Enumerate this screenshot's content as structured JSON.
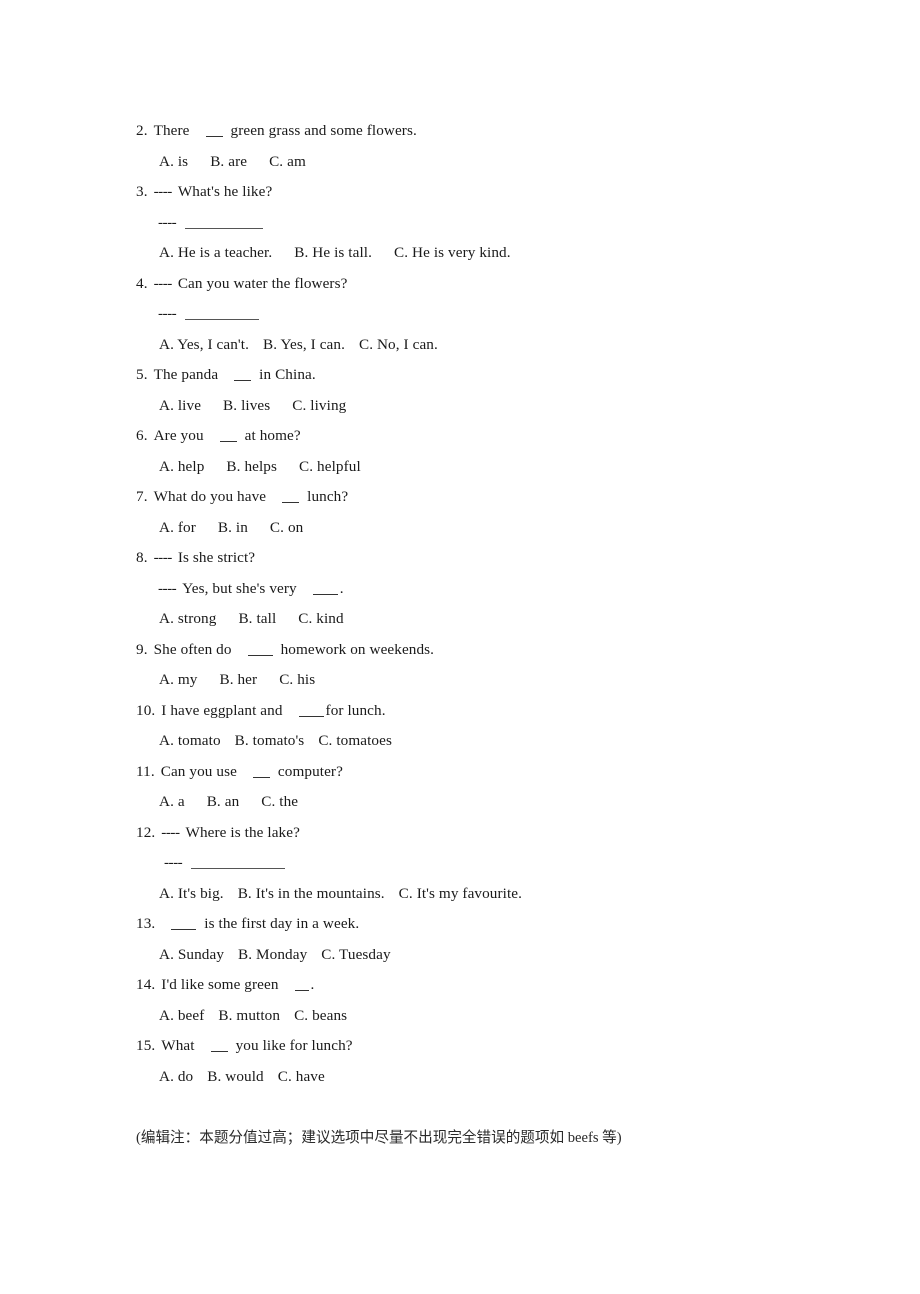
{
  "document": {
    "type": "english-multiple-choice-worksheet",
    "background_color": "#ffffff",
    "text_color": "#1a1a1a"
  },
  "questions": [
    {
      "number": "2.",
      "stem_before": "There",
      "stem_after": "green grass and some flowers.",
      "blank": "__",
      "options": [
        "A. is",
        "B. are",
        "C. am"
      ]
    },
    {
      "number": "3.",
      "prompt_dash": "----",
      "prompt": "What's he like?",
      "reply_dash": "----",
      "options": [
        "A. He is a teacher.",
        "B. He is tall.",
        "C. He is very kind."
      ]
    },
    {
      "number": "4.",
      "prompt_dash": "----",
      "prompt": "Can you water the flowers?",
      "reply_dash": "----",
      "options": [
        "A. Yes, I can't.",
        "B. Yes, I can.",
        "C. No, I can."
      ]
    },
    {
      "number": "5.",
      "stem_before": "The panda",
      "stem_after": "in China.",
      "blank": "__",
      "options": [
        "A. live",
        "B. lives",
        "C. living"
      ]
    },
    {
      "number": "6.",
      "stem_before": "Are you",
      "stem_after": "at home?",
      "blank": "__",
      "options": [
        "A. help",
        "B. helps",
        "C. helpful"
      ]
    },
    {
      "number": "7.",
      "stem_before": "What do you have",
      "stem_after": "lunch?",
      "blank": "__",
      "options": [
        "A. for",
        "B. in",
        "C. on"
      ]
    },
    {
      "number": "8.",
      "prompt_dash": "----",
      "prompt": "Is she strict?",
      "reply_dash": "----",
      "reply_before": "Yes, but she's very",
      "reply_after": ".",
      "reply_blank": "___",
      "options": [
        "A. strong",
        "B. tall",
        "C. kind"
      ]
    },
    {
      "number": "9.",
      "stem_before": "She often do",
      "stem_after": "homework on weekends.",
      "blank": "___",
      "options": [
        "A. my",
        "B. her",
        "C. his"
      ]
    },
    {
      "number": "10.",
      "stem_before": "I have eggplant and",
      "stem_after": "for lunch.",
      "blank": "___",
      "options": [
        "A. tomato",
        "B. tomato's",
        "C. tomatoes"
      ]
    },
    {
      "number": "11.",
      "stem_before": "Can you use",
      "stem_after": "computer?",
      "blank": "__",
      "options": [
        "A. a",
        "B. an",
        "C. the"
      ]
    },
    {
      "number": "12.",
      "prompt_dash": "----",
      "prompt": "Where is the lake?",
      "reply_dash": "----",
      "options": [
        "A. It's big.",
        "B. It's in the mountains.",
        "C. It's my favourite."
      ]
    },
    {
      "number": "13.",
      "stem_before": "",
      "stem_after": "is the first day in a week.",
      "blank": "___",
      "options": [
        "A. Sunday",
        "B. Monday",
        "C. Tuesday"
      ]
    },
    {
      "number": "14.",
      "stem_before": "I'd like some green",
      "stem_after": ".",
      "blank": "___",
      "options": [
        "A. beef",
        "B. mutton",
        "C. beans"
      ]
    },
    {
      "number": "15.",
      "stem_before": "What",
      "stem_after": "you like for lunch?",
      "blank": "__",
      "options": [
        "A. do",
        "B. would",
        "C. have"
      ]
    }
  ],
  "editor_note": "(编辑注：本题分值过高；建议选项中尽量不出现完全错误的题项如 beefs 等)"
}
